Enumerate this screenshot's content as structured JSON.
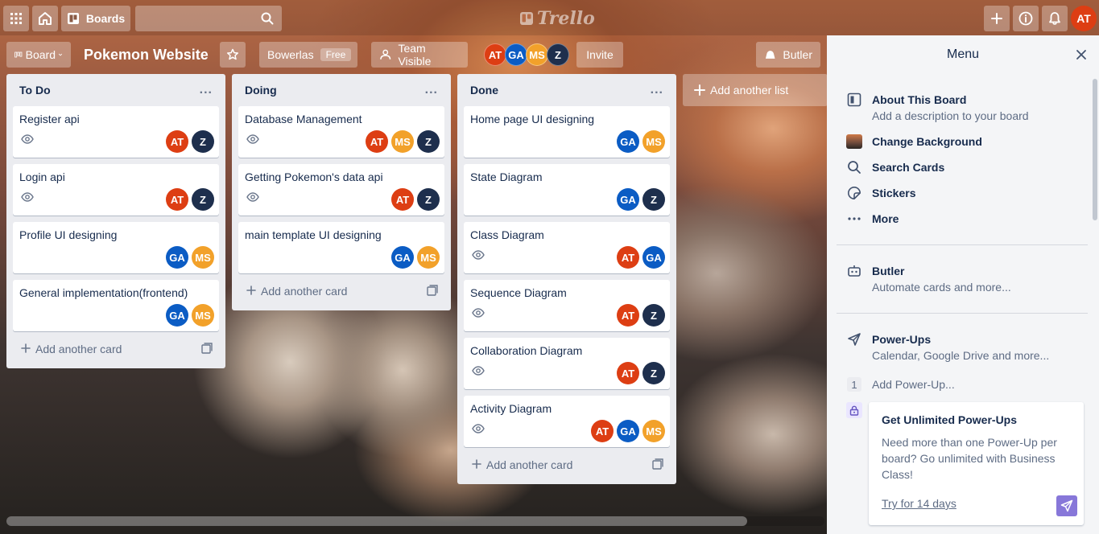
{
  "topbar": {
    "boards_label": "Boards",
    "search_placeholder": "",
    "logo_text": "Trello",
    "user_initials": "AT"
  },
  "board": {
    "view_label": "Board",
    "title": "Pokemon Website",
    "team_name": "Bowerlas",
    "team_plan": "Free",
    "visibility_label": "Team Visible",
    "invite_label": "Invite",
    "butler_label": "Butler",
    "members": [
      "AT",
      "GA",
      "MS",
      "Z"
    ]
  },
  "member_colors": {
    "AT": "#dd3e13",
    "GA": "#0b5cc4",
    "MS": "#f2a12a",
    "Z": "#1e2f4d"
  },
  "lists": [
    {
      "title": "To Do",
      "menu": "...",
      "cards": [
        {
          "title": "Register api",
          "watched": true,
          "members": [
            "AT",
            "Z"
          ]
        },
        {
          "title": "Login api",
          "watched": true,
          "members": [
            "AT",
            "Z"
          ]
        },
        {
          "title": "Profile UI designing",
          "watched": false,
          "members": [
            "GA",
            "MS"
          ]
        },
        {
          "title": "General implementation(frontend)",
          "watched": false,
          "members": [
            "GA",
            "MS"
          ]
        }
      ],
      "add_card_label": "Add another card"
    },
    {
      "title": "Doing",
      "menu": "...",
      "cards": [
        {
          "title": "Database Management",
          "watched": true,
          "members": [
            "AT",
            "MS",
            "Z"
          ]
        },
        {
          "title": "Getting Pokemon's data api",
          "watched": true,
          "members": [
            "AT",
            "Z"
          ]
        },
        {
          "title": "main template UI designing",
          "watched": false,
          "members": [
            "GA",
            "MS"
          ]
        }
      ],
      "add_card_label": "Add another card"
    },
    {
      "title": "Done",
      "menu": "...",
      "cards": [
        {
          "title": "Home page UI designing",
          "watched": false,
          "members": [
            "GA",
            "MS"
          ]
        },
        {
          "title": "State Diagram",
          "watched": false,
          "members": [
            "GA",
            "Z"
          ]
        },
        {
          "title": "Class Diagram",
          "watched": true,
          "members": [
            "AT",
            "GA"
          ]
        },
        {
          "title": "Sequence Diagram",
          "watched": true,
          "members": [
            "AT",
            "Z"
          ]
        },
        {
          "title": "Collaboration Diagram",
          "watched": true,
          "members": [
            "AT",
            "Z"
          ]
        },
        {
          "title": "Activity Diagram",
          "watched": true,
          "members": [
            "AT",
            "GA",
            "MS"
          ]
        }
      ],
      "add_card_label": "Add another card"
    }
  ],
  "add_list_label": "Add another list",
  "menu": {
    "title": "Menu",
    "about": {
      "title": "About This Board",
      "subtitle": "Add a description to your board"
    },
    "change_background": "Change Background",
    "search_cards": "Search Cards",
    "stickers": "Stickers",
    "more": "More",
    "butler": {
      "title": "Butler",
      "subtitle": "Automate cards and more..."
    },
    "powerups": {
      "title": "Power-Ups",
      "subtitle": "Calendar, Google Drive and more...",
      "count": "1",
      "add_label": "Add Power-Up..."
    },
    "promo": {
      "title": "Get Unlimited Power-Ups",
      "text": "Need more than one Power-Up per board? Go unlimited with Business Class!",
      "link": "Try for 14 days"
    }
  }
}
